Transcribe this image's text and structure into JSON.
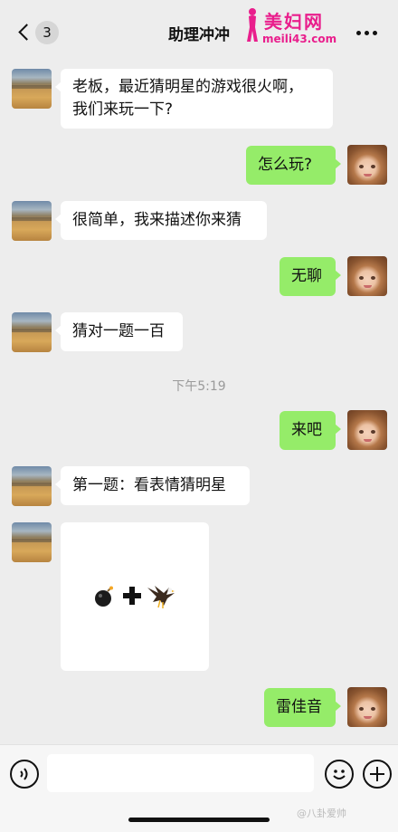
{
  "header": {
    "title": "助理冲冲",
    "unread_count": "3"
  },
  "watermark": {
    "site_cn": "美妇网",
    "site_url": "meili43.com",
    "weibo_tag": "@八卦爱帅"
  },
  "messages": [
    {
      "side": "left",
      "text": "老板，最近猜明星的游戏很火啊，\n我们来玩一下?"
    },
    {
      "side": "right",
      "text": "怎么玩?"
    },
    {
      "side": "left",
      "text": "很简单，我来描述你来猜"
    },
    {
      "side": "right",
      "text": "无聊"
    },
    {
      "side": "left",
      "text": "猜对一题一百"
    },
    {
      "side": "right",
      "text": "来吧"
    },
    {
      "side": "left",
      "text": "第一题：看表情猜明星"
    },
    {
      "side": "left",
      "type": "emoji",
      "icons": [
        "bomb-icon",
        "plus-icon",
        "eagle-icon"
      ]
    },
    {
      "side": "right",
      "text": "雷佳音"
    }
  ],
  "timestamp": "下午5:19",
  "colors": {
    "background": "#ededed",
    "bubble_self": "#95ec69",
    "bubble_other": "#ffffff",
    "watermark": "#e91e8c"
  }
}
